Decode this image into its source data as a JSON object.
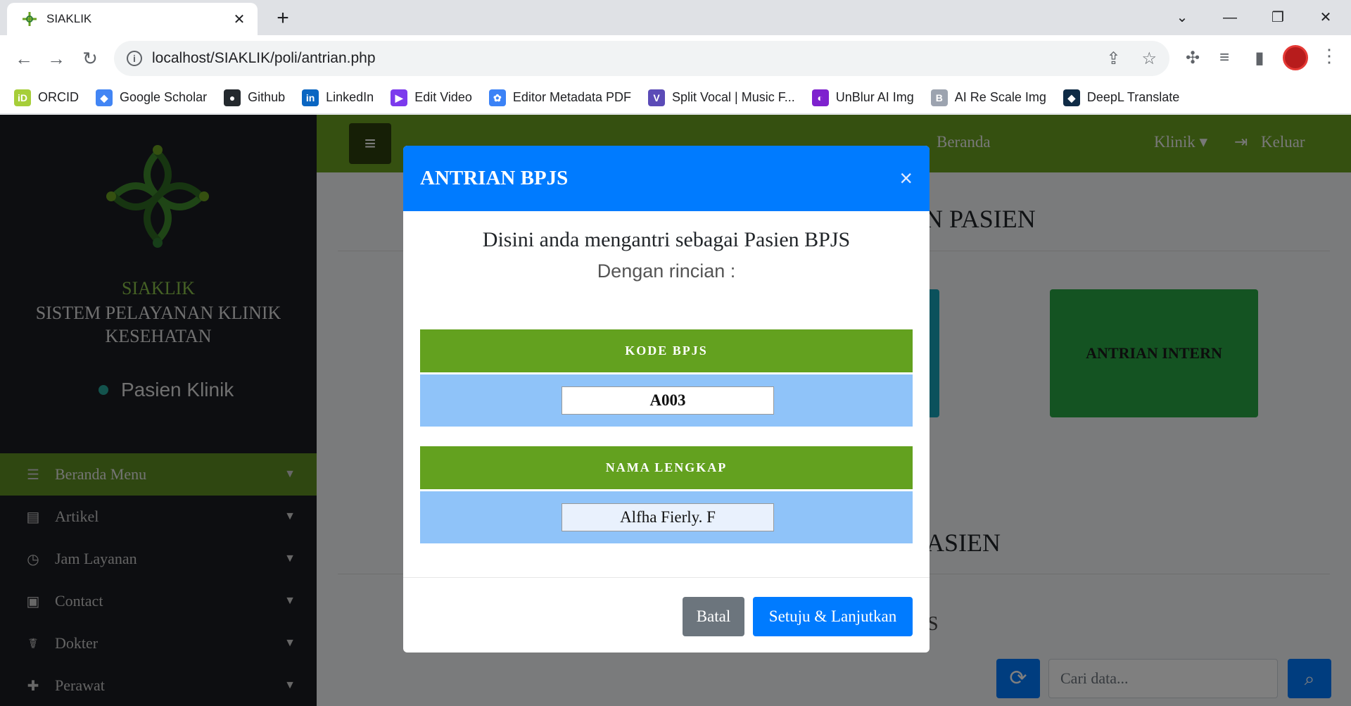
{
  "browser": {
    "tab_title": "SIAKLIK",
    "tab_close": "✕",
    "new_tab": "+",
    "url": "localhost/SIAKLIK/poli/antrian.php",
    "bookmarks": [
      {
        "label": "ORCID",
        "icon": "orcid-icon",
        "color": "#a6ce39",
        "glyph": "iD"
      },
      {
        "label": "Google Scholar",
        "icon": "google-scholar-icon",
        "color": "#4285f4",
        "glyph": "◆"
      },
      {
        "label": "Github",
        "icon": "github-icon",
        "color": "#24292e",
        "glyph": "●"
      },
      {
        "label": "LinkedIn",
        "icon": "linkedin-icon",
        "color": "#0a66c2",
        "glyph": "in"
      },
      {
        "label": "Edit Video",
        "icon": "edit-video-icon",
        "color": "#7c3aed",
        "glyph": "▶"
      },
      {
        "label": "Editor Metadata PDF",
        "icon": "metadata-icon",
        "color": "#3b82f6",
        "glyph": "✿"
      },
      {
        "label": "Split Vocal | Music F...",
        "icon": "split-vocal-icon",
        "color": "#5b4bb7",
        "glyph": "V"
      },
      {
        "label": "UnBlur AI Img",
        "icon": "unblur-icon",
        "color": "#7e22ce",
        "glyph": "◐"
      },
      {
        "label": "AI Re Scale Img",
        "icon": "rescale-icon",
        "color": "#9ca3af",
        "glyph": "B"
      },
      {
        "label": "DeepL Translate",
        "icon": "deepl-icon",
        "color": "#0f2b46",
        "glyph": "◆"
      }
    ]
  },
  "sidebar": {
    "brand_name": "SIAKLIK",
    "brand_sub": "SISTEM PELAYANAN KLINIK KESEHATAN",
    "user_status": "Pasien Klinik",
    "menu": [
      {
        "label": "Beranda Menu",
        "icon": "☰",
        "active": true
      },
      {
        "label": "Artikel",
        "icon": "▤",
        "active": false
      },
      {
        "label": "Jam Layanan",
        "icon": "◷",
        "active": false
      },
      {
        "label": "Contact",
        "icon": "▣",
        "active": false
      },
      {
        "label": "Dokter",
        "icon": "☤",
        "active": false
      },
      {
        "label": "Perawat",
        "icon": "✚",
        "active": false
      }
    ]
  },
  "topnav": {
    "beranda": "Beranda",
    "klinik": "Klinik ▾",
    "keluar": "Keluar"
  },
  "main": {
    "section1_partial": "AN PASIEN",
    "card_intern": "ANTRIAN INTERN",
    "section2_partial": "ASIEN",
    "section3_partial": "S",
    "search_placeholder": "Cari data..."
  },
  "modal": {
    "title": "ANTRIAN BPJS",
    "close": "×",
    "intro": "Disini anda mengantri sebagai Pasien BPJS",
    "sub": "Dengan rincian :",
    "kode_label": "KODE BPJS",
    "kode_value": "A003",
    "nama_label": "NAMA LENGKAP",
    "nama_value": "Alfha Fierly. F",
    "btn_cancel": "Batal",
    "btn_confirm": "Setuju & Lanjutkan"
  },
  "colors": {
    "accent_green": "#6aa121",
    "modal_blue": "#007bff",
    "sidebar_bg": "#1b1c22"
  }
}
